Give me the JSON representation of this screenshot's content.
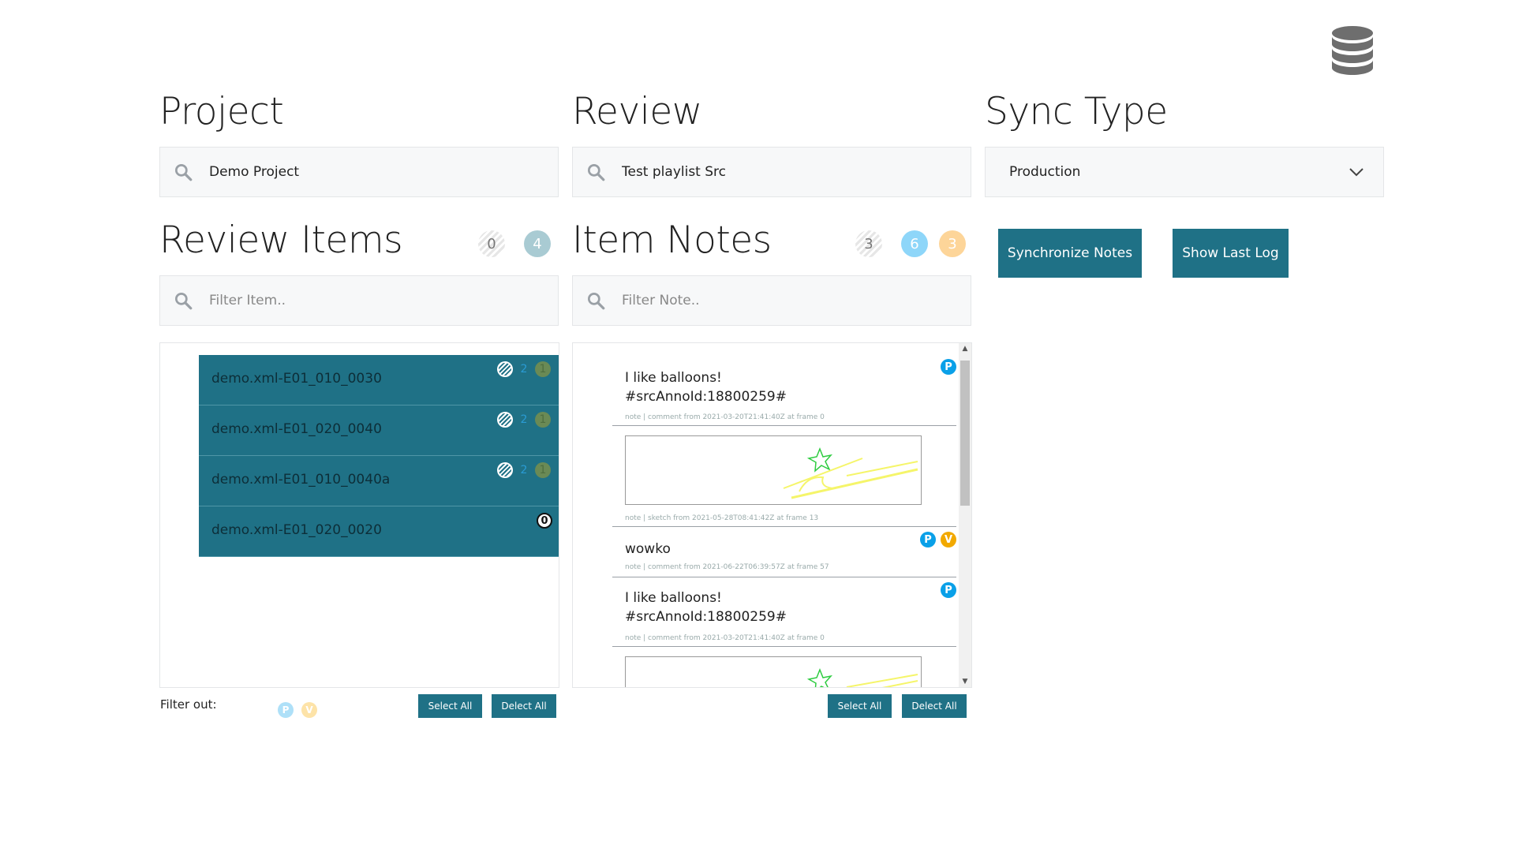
{
  "db_icon": "database-icon",
  "project": {
    "heading": "Project",
    "search_value": "Demo Project"
  },
  "review": {
    "heading": "Review",
    "search_value": "Test playlist Src"
  },
  "sync_type": {
    "heading": "Sync Type",
    "selected": "Production"
  },
  "review_items": {
    "heading": "Review Items",
    "count_done": "0",
    "count_total": "4",
    "filter_placeholder": "Filter Item..",
    "items": [
      {
        "name": "demo.xml-E01_010_0030",
        "num_a": "2",
        "num_b": "1"
      },
      {
        "name": "demo.xml-E01_020_0040",
        "num_a": "2",
        "num_b": "1"
      },
      {
        "name": "demo.xml-E01_010_0040a",
        "num_a": "2",
        "num_b": "1"
      },
      {
        "name": "demo.xml-E01_020_0020",
        "zero": "0"
      }
    ],
    "filter_out_label": "Filter out:",
    "filter_out_tags": [
      "P",
      "V"
    ],
    "select_all": "Select All",
    "deselect_all": "Delect All"
  },
  "item_notes": {
    "heading": "Item Notes",
    "count_grey": "3",
    "count_blue": "6",
    "count_orange": "3",
    "filter_placeholder": "Filter Note..",
    "notes": [
      {
        "line1": "I like balloons!",
        "line2": "#srcAnnoId:18800259#",
        "meta": "note | comment from 2021-03-20T21:41:40Z at frame 0",
        "tags": [
          "P"
        ]
      },
      {
        "meta": "note | sketch from 2021-05-28T08:41:42Z at frame 13"
      },
      {
        "line1": "wowko",
        "meta": "note | comment from 2021-06-22T06:39:57Z at frame 57",
        "tags": [
          "P",
          "V"
        ]
      },
      {
        "line1": "I like balloons!",
        "line2": "#srcAnnoId:18800259#",
        "meta": "note | comment from 2021-03-20T21:41:40Z at frame 0",
        "tags": [
          "P"
        ]
      }
    ],
    "select_all": "Select All",
    "deselect_all": "Delect All"
  },
  "actions": {
    "synchronize": "Synchronize Notes",
    "show_log": "Show Last Log"
  },
  "colors": {
    "accent": "#1f7186",
    "tag_p": "#0aa0e8",
    "tag_v": "#f2a900"
  }
}
